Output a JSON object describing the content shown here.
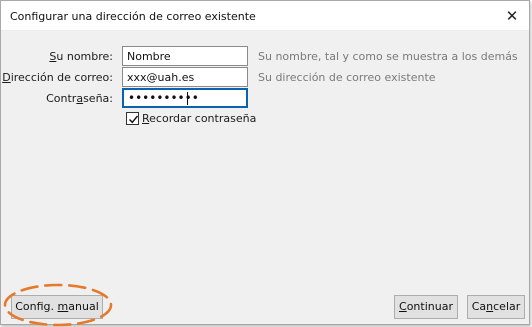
{
  "dialog": {
    "title": "Configurar una dirección de correo existente",
    "close_glyph": "✕"
  },
  "form": {
    "name": {
      "label_access": "S",
      "label_rest": "u nombre:",
      "value": "Nombre",
      "hint": "Su nombre, tal y como se muestra a los demás"
    },
    "email": {
      "label_access": "D",
      "label_rest": "irección de correo:",
      "value": "xxx@uah.es",
      "hint": "Su dirección de correo existente"
    },
    "password": {
      "label_pre": "Contr",
      "label_access": "a",
      "label_rest": "seña:",
      "masked": "••••••••••"
    },
    "remember": {
      "checked": true,
      "label_access": "R",
      "label_rest": "ecordar contraseña"
    }
  },
  "buttons": {
    "manual": {
      "pre": "Config. ",
      "access": "m",
      "rest": "anual"
    },
    "continue": {
      "access": "C",
      "rest": "ontinuar"
    },
    "cancel": {
      "pre": "Ca",
      "access": "n",
      "rest": "celar"
    }
  },
  "annotation": {
    "color": "#e8792a",
    "style": "dashed-ellipse"
  }
}
